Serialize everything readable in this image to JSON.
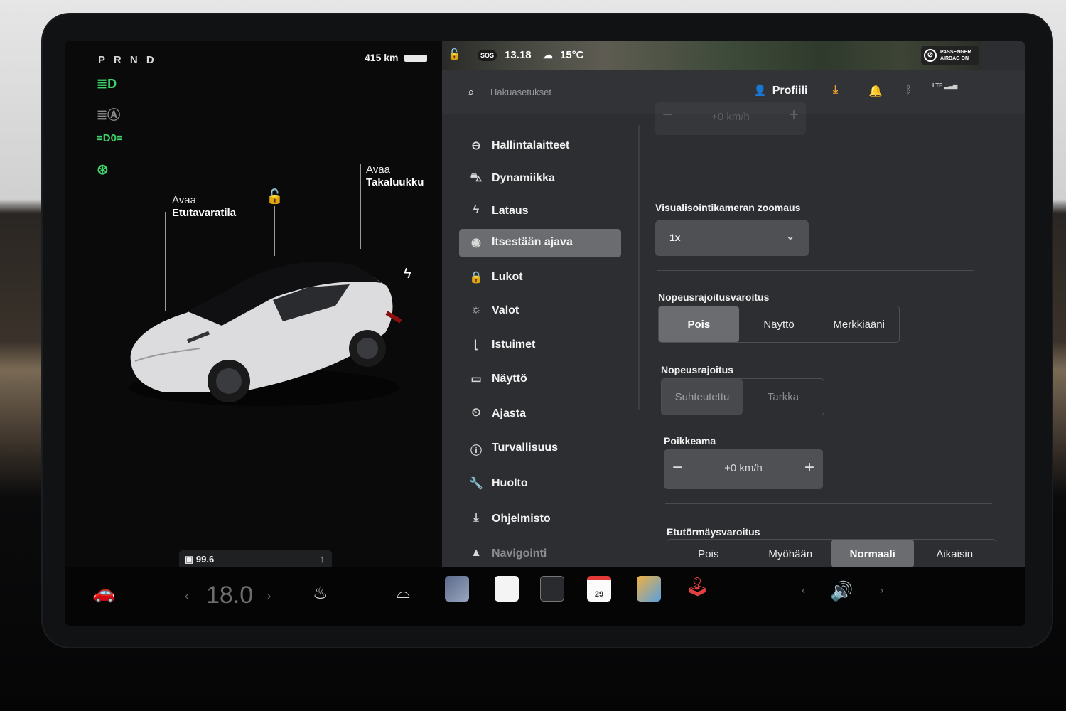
{
  "car_pane": {
    "gear": "P R N D",
    "range": "415 km",
    "indicators": [
      {
        "icon": "low-beam-headlight-icon",
        "glyph": "≣D",
        "color": "#3fd36a"
      },
      {
        "icon": "auto-high-beam-icon",
        "glyph": "≣Ⓐ",
        "color": "#8a8a8a"
      },
      {
        "icon": "parking-lights-icon",
        "glyph": "≡D0≡",
        "color": "#3fd36a"
      },
      {
        "icon": "charge-port-icon",
        "glyph": "ⓘ",
        "color": "#3fd36a"
      }
    ],
    "frunk_line1": "Avaa",
    "frunk_line2": "Etutavaratila",
    "trunk_line1": "Avaa",
    "trunk_line2": "Takaluukku",
    "odometer": "99.6"
  },
  "statusbar": {
    "sos": "SOS",
    "time": "13.18",
    "temperature": "15°C",
    "airbag_line1": "PASSENGER",
    "airbag_line2": "AIRBAG ON"
  },
  "topbar": {
    "search_placeholder": "Hakuasetukset",
    "profile_label": "Profiili",
    "network": "LTE"
  },
  "nav": {
    "items": [
      {
        "label": "Hallintalaitteet",
        "icon": "toggle-icon",
        "glyph": "⊖"
      },
      {
        "label": "Dynamiikka",
        "icon": "car-icon",
        "glyph": "🚘"
      },
      {
        "label": "Lataus",
        "icon": "bolt-icon",
        "glyph": "ϟ"
      },
      {
        "label": "Itsestään ajava",
        "icon": "steering-wheel-icon",
        "glyph": "◉"
      },
      {
        "label": "Lukot",
        "icon": "lock-icon",
        "glyph": "🔒"
      },
      {
        "label": "Valot",
        "icon": "sun-icon",
        "glyph": "☼"
      },
      {
        "label": "Istuimet",
        "icon": "seat-icon",
        "glyph": "⌊"
      },
      {
        "label": "Näyttö",
        "icon": "display-icon",
        "glyph": "▭"
      },
      {
        "label": "Ajasta",
        "icon": "alarm-clock-icon",
        "glyph": "⏰"
      },
      {
        "label": "Turvallisuus",
        "icon": "info-circle-icon",
        "glyph": "ⓘ"
      },
      {
        "label": "Huolto",
        "icon": "wrench-icon",
        "glyph": "🔧"
      },
      {
        "label": "Ohjelmisto",
        "icon": "download-icon",
        "glyph": "⤓"
      },
      {
        "label": "Navigointi",
        "icon": "navigation-arrow-icon",
        "glyph": "▲"
      }
    ],
    "active_index": 3
  },
  "content": {
    "top_stepper_value": "+0 km/h",
    "zoom_title": "Visualisointikameran zoomaus",
    "zoom_value": "1x",
    "speed_warning_title": "Nopeusrajoitusvaroitus",
    "speed_warning_options": [
      "Pois",
      "Näyttö",
      "Merkkiääni"
    ],
    "speed_warning_selected": "Pois",
    "speed_limit_title": "Nopeusrajoitus",
    "speed_limit_options": [
      "Suhteutettu",
      "Tarkka"
    ],
    "speed_limit_selected": "Suhteutettu",
    "offset_title": "Poikkeama",
    "offset_value": "+0 km/h",
    "collision_title": "Etutörmäysvaroitus",
    "collision_options": [
      "Pois",
      "Myöhään",
      "Normaali",
      "Aikaisin"
    ],
    "collision_selected": "Normaali"
  },
  "dock": {
    "cabin_temp": "18.0",
    "calendar_day": "29"
  },
  "colors": {
    "accent_green": "#3fd36a",
    "selected_segment": "#6b6c70",
    "panel_bg": "#2d2e31",
    "download_orange": "#f0a030"
  }
}
